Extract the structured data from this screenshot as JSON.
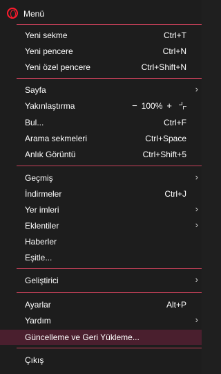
{
  "header": {
    "label": "Menü",
    "icon": "opera-logo-icon",
    "accent": "#ff1b2d"
  },
  "groups": [
    [
      {
        "label": "Yeni sekme",
        "shortcut": "Ctrl+T"
      },
      {
        "label": "Yeni pencere",
        "shortcut": "Ctrl+N"
      },
      {
        "label": "Yeni özel pencere",
        "shortcut": "Ctrl+Shift+N"
      }
    ],
    [
      {
        "label": "Sayfa",
        "submenu": true
      },
      {
        "label": "Yakınlaştırma",
        "zoom": {
          "minus": "−",
          "value": "100%",
          "plus": "+"
        }
      },
      {
        "label": "Bul...",
        "shortcut": "Ctrl+F"
      },
      {
        "label": "Arama sekmeleri",
        "shortcut": "Ctrl+Space"
      },
      {
        "label": "Anlık Görüntü",
        "shortcut": "Ctrl+Shift+5"
      }
    ],
    [
      {
        "label": "Geçmiş",
        "submenu": true
      },
      {
        "label": "İndirmeler",
        "shortcut": "Ctrl+J"
      },
      {
        "label": "Yer imleri",
        "submenu": true
      },
      {
        "label": "Eklentiler",
        "submenu": true
      },
      {
        "label": "Haberler"
      },
      {
        "label": "Eşitle..."
      }
    ],
    [
      {
        "label": "Geliştirici",
        "submenu": true
      }
    ],
    [
      {
        "label": "Ayarlar",
        "shortcut": "Alt+P"
      },
      {
        "label": "Yardım",
        "submenu": true
      },
      {
        "label": "Güncelleme ve Geri Yükleme...",
        "highlighted": true
      }
    ],
    [
      {
        "label": "Çıkış"
      }
    ]
  ],
  "arrow_glyph": "›",
  "separator_color": "#c8415a",
  "highlight_color": "#4a1f2e"
}
